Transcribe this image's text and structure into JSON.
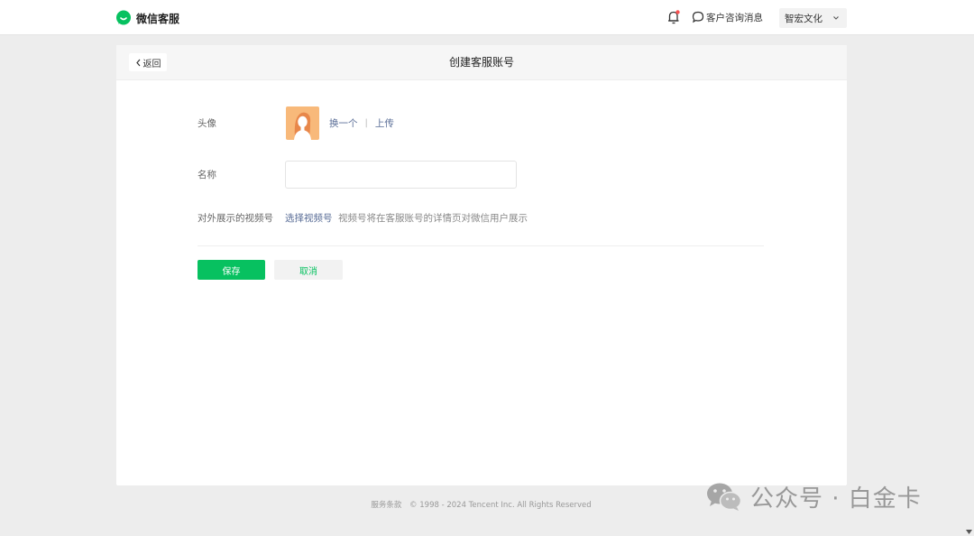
{
  "header": {
    "brand": "微信客服",
    "consult_label": "客户咨询消息",
    "account_name": "智宏文化",
    "icons": {
      "logo": "wechat-service-logo",
      "bell": "bell-icon",
      "chat": "chat-bubble-icon",
      "chevron": "chevron-down-icon"
    },
    "colors": {
      "brand": "#07c160",
      "notification_dot": "#fa5151"
    }
  },
  "page": {
    "back_label": "返回",
    "title": "创建客服账号"
  },
  "form": {
    "avatar": {
      "label": "头像",
      "change_label": "换一个",
      "separator": "|",
      "upload_label": "上传"
    },
    "name": {
      "label": "名称",
      "value": "",
      "placeholder": ""
    },
    "channel": {
      "label": "对外展示的视频号",
      "select_label": "选择视频号",
      "hint": "视频号将在客服账号的详情页对微信用户展示"
    },
    "save_label": "保存",
    "cancel_label": "取消",
    "colors": {
      "primary": "#07c160",
      "link": "#576b95"
    }
  },
  "footer": {
    "terms_label": "服务条款",
    "copyright": "© 1998 - 2024 Tencent Inc. All Rights Reserved"
  },
  "watermark": {
    "text": "公众号 · 白金卡"
  }
}
